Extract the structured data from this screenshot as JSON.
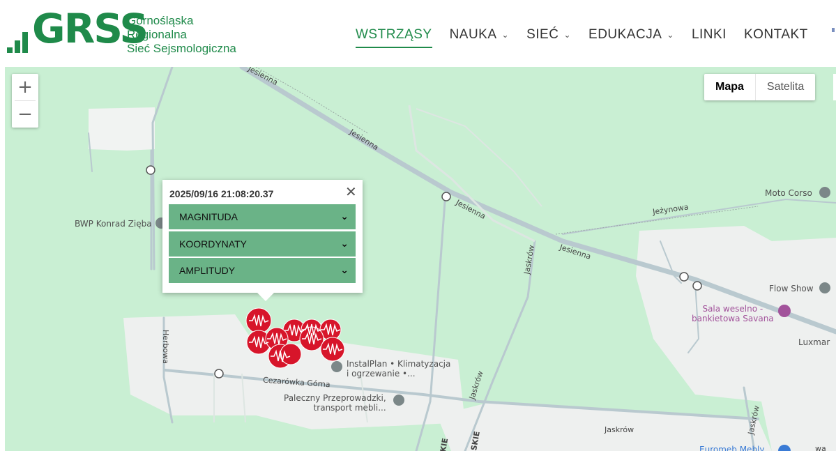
{
  "header": {
    "logo_text": "GRSS",
    "logo_sub": [
      "Górnośląska",
      "Regionalna",
      "Sieć Sejsmologiczna"
    ],
    "nav": [
      {
        "label": "WSTRZĄSY",
        "active": true,
        "dropdown": false
      },
      {
        "label": "NAUKA",
        "active": false,
        "dropdown": true
      },
      {
        "label": "SIEĆ",
        "active": false,
        "dropdown": true
      },
      {
        "label": "EDUKACJA",
        "active": false,
        "dropdown": true
      },
      {
        "label": "LINKI",
        "active": false,
        "dropdown": false
      },
      {
        "label": "KONTAKT",
        "active": false,
        "dropdown": false
      }
    ],
    "brand_color": "#1f8a4a"
  },
  "map": {
    "zoom_in": "+",
    "zoom_out": "−",
    "map_type": [
      "Mapa",
      "Satelita"
    ],
    "roads": {
      "jesienna_1": "Jesienna",
      "jesienna_2": "Jesienna",
      "jesienna_3": "Jesienna",
      "jesienna_4": "Jesienna",
      "jezynowa": "Jeżynowa",
      "jaskrow_1": "Jaskrów",
      "jaskrow_2": "Jaskrów",
      "jaskrow_3": "Jaskrów",
      "jaskrow_4": "Jaskrów",
      "herbowa": "Herbowa",
      "cezarowka": "Cezarówka Górna",
      "skie_1": "KIE",
      "skie_2": "SKIE",
      "edge": "wa"
    },
    "pois": {
      "bwp": "BWP Konrad Zięba",
      "moto_corso": "Moto Corso",
      "flow_show": "Flow Show",
      "sala_1": "Sala weselno -",
      "sala_2": "bankietowa Savana",
      "luxmar": "Luxmar",
      "instalplan_1": "InstalPlan • Klimatyzacja",
      "instalplan_2": "i ogrzewanie •...",
      "paleczny_1": "Paleczny Przeprowadzki,",
      "paleczny_2": "transport mebli...",
      "euromeb": "Euromeb Mebly"
    },
    "event_marker_color": "#d7152a"
  },
  "popup": {
    "datetime": "2025/09/16 21:08:20.37",
    "close_icon": "close-icon",
    "sections": [
      "MAGNITUDA",
      "KOORDYNATY",
      "AMPLITUDY"
    ]
  }
}
